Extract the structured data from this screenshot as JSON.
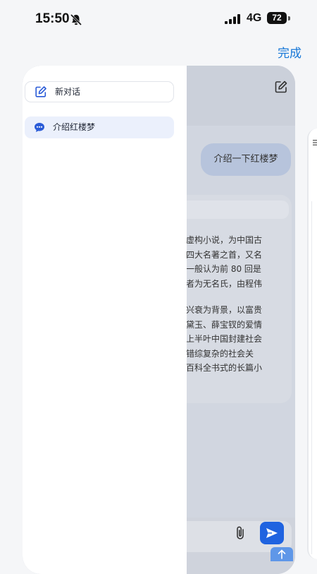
{
  "status_bar": {
    "time": "15:50",
    "network": "4G",
    "battery": "72"
  },
  "header": {
    "done_label": "完成"
  },
  "sidebar": {
    "new_chat_label": "新对话",
    "history": [
      {
        "label": "介绍红楼梦"
      }
    ]
  },
  "chat": {
    "user_message": "介绍一下红楼梦",
    "answer_paragraph_1": "虚构小说，为中国古\n四大名著之首，又名\n一般认为前 80 回是\n者为无名氏，由程伟",
    "answer_paragraph_2": "兴衰为背景，以富贵\n黛玉、薛宝钗的爱情\n上半叶中国封建社会\n错综复杂的社会关\n百科全书式的长篇小"
  },
  "colors": {
    "accent": "#1677d7",
    "send_button": "#1f63e0",
    "sidebar_highlight": "#ebf0fc"
  }
}
